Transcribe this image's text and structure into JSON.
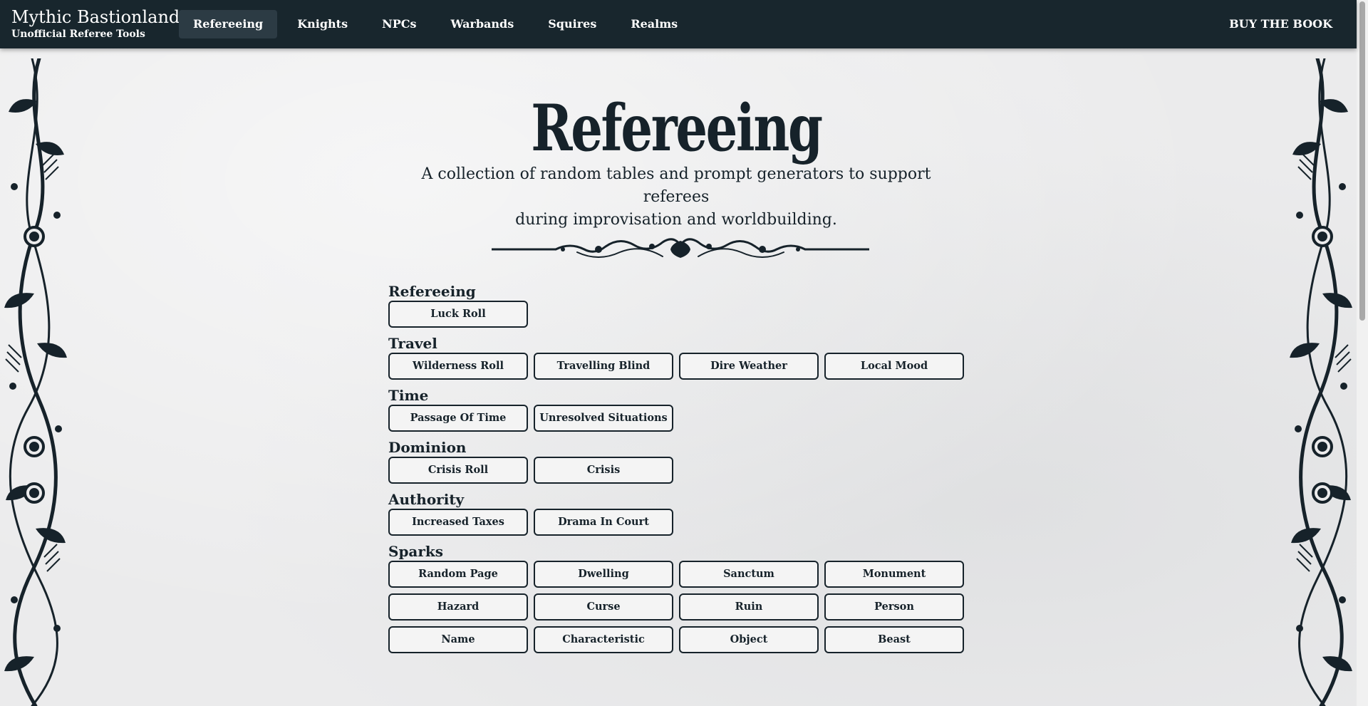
{
  "brand": {
    "title": "Mythic Bastionland",
    "subtitle": "Unofficial Referee Tools"
  },
  "nav": {
    "items": [
      {
        "label": "Refereeing",
        "active": true
      },
      {
        "label": "Knights",
        "active": false
      },
      {
        "label": "NPCs",
        "active": false
      },
      {
        "label": "Warbands",
        "active": false
      },
      {
        "label": "Squires",
        "active": false
      },
      {
        "label": "Realms",
        "active": false
      }
    ],
    "buy_label": "BUY THE BOOK"
  },
  "page": {
    "title": "Refereeing",
    "subtitle_line1": "A collection of random tables and prompt generators to support referees",
    "subtitle_line2": "during improvisation and worldbuilding."
  },
  "sections": [
    {
      "title": "Refereeing",
      "buttons": [
        "Luck Roll"
      ]
    },
    {
      "title": "Travel",
      "buttons": [
        "Wilderness Roll",
        "Travelling Blind",
        "Dire Weather",
        "Local Mood"
      ]
    },
    {
      "title": "Time",
      "buttons": [
        "Passage Of Time",
        "Unresolved Situations"
      ]
    },
    {
      "title": "Dominion",
      "buttons": [
        "Crisis Roll",
        "Crisis"
      ]
    },
    {
      "title": "Authority",
      "buttons": [
        "Increased Taxes",
        "Drama In Court"
      ]
    },
    {
      "title": "Sparks",
      "buttons": [
        "Random Page",
        "Dwelling",
        "Sanctum",
        "Monument",
        "Hazard",
        "Curse",
        "Ruin",
        "Person",
        "Name",
        "Characteristic",
        "Object",
        "Beast"
      ]
    }
  ],
  "colors": {
    "navbar": "#18262d",
    "ink": "#16222a",
    "paper": "#ebebec",
    "active_tab": "#2c3b44"
  }
}
